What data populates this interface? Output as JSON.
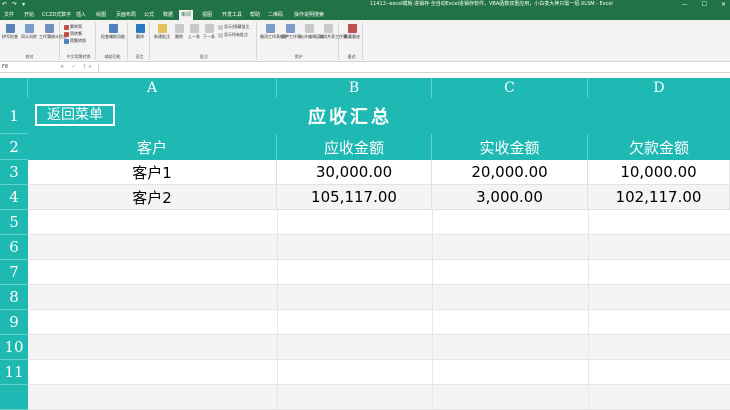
{
  "titlebar": {
    "qat": [
      "↶",
      "↷",
      "▾"
    ],
    "title": "11412--excel模板·进销存·全自动Excel进销存软件，VBA函数双重应用，小白变大神只需一招.XLSM - Excel",
    "controls": [
      "—",
      "☐",
      "✕"
    ]
  },
  "tabs": [
    "文件",
    "开始",
    "CCZD式数字",
    "插入",
    "绘图",
    "页面布局",
    "公式",
    "数据",
    "审阅",
    "视图",
    "开发工具",
    "帮助",
    "二维码",
    "操作说明搜索"
  ],
  "active_tab_index": 8,
  "ribbon": {
    "groups": [
      {
        "label": "校对",
        "buttons": [
          "拼写检查",
          "同义词库",
          "工作簿统计信息"
        ]
      },
      {
        "label": "中文简繁转换",
        "buttons": [
          "繁转简",
          "简转繁",
          "简繁转换"
        ]
      },
      {
        "label": "辅助功能",
        "buttons": [
          "检查辅助功能"
        ]
      },
      {
        "label": "语言",
        "buttons": [
          "翻译"
        ]
      },
      {
        "label": "批注",
        "buttons": [
          "新建批注",
          "删除",
          "上一条",
          "下一条",
          "显示/隐藏批注",
          "显示所有批注"
        ]
      },
      {
        "label": "保护",
        "buttons": [
          "撤消工作表保护",
          "保护工作簿",
          "允许编辑区域",
          "取消共享工作簿"
        ]
      },
      {
        "label": "墨迹",
        "buttons": [
          "隐藏墨迹"
        ]
      }
    ]
  },
  "formula_bar": {
    "name_box": "F8",
    "icons": "✕ ✓ fx",
    "value": ""
  },
  "sheet": {
    "columns": [
      "A",
      "B",
      "C",
      "D"
    ],
    "rows": [
      "1",
      "2",
      "3",
      "4",
      "5",
      "6",
      "7",
      "8",
      "9",
      "10",
      "11"
    ],
    "back_button": "返回菜单",
    "title": "应收汇总",
    "headers": [
      "客户",
      "应收金额",
      "实收金额",
      "欠款金额"
    ],
    "data": [
      [
        "客户1",
        "30,000.00",
        "20,000.00",
        "10,000.00"
      ],
      [
        "客户2",
        "105,117.00",
        "3,000.00",
        "102,117.00"
      ]
    ]
  },
  "colors": {
    "excel_green": "#217346",
    "teal": "#1fb9b4"
  }
}
